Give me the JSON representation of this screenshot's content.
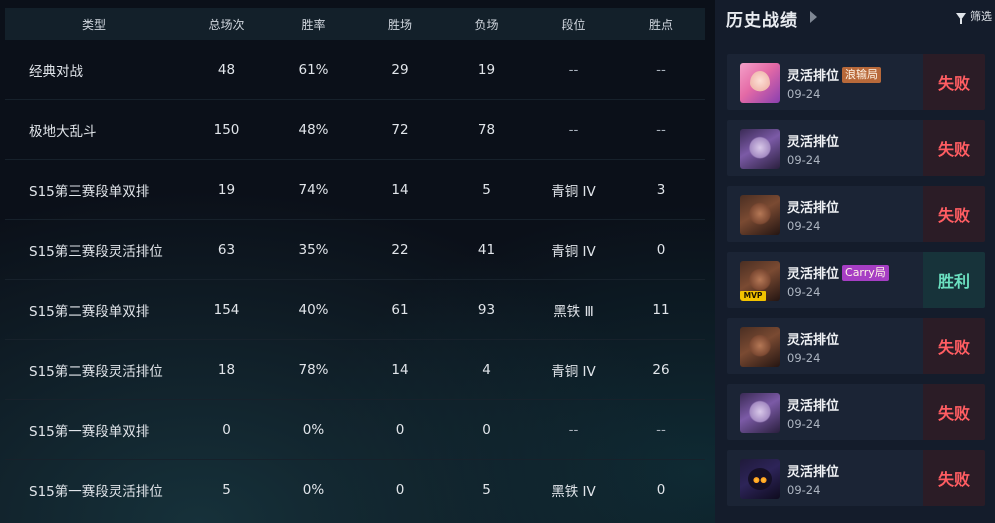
{
  "stats": {
    "headers": {
      "type": "类型",
      "total": "总场次",
      "rate": "胜率",
      "wins": "胜场",
      "losses": "负场",
      "rank": "段位",
      "lp": "胜点"
    },
    "rows": [
      {
        "type": "经典对战",
        "total": "48",
        "rate": "61%",
        "wins": "29",
        "losses": "19",
        "rank": "--",
        "lp": "--"
      },
      {
        "type": "极地大乱斗",
        "total": "150",
        "rate": "48%",
        "wins": "72",
        "losses": "78",
        "rank": "--",
        "lp": "--"
      },
      {
        "type": "S15第三赛段单双排",
        "total": "19",
        "rate": "74%",
        "wins": "14",
        "losses": "5",
        "rank": "青铜 IV",
        "lp": "3"
      },
      {
        "type": "S15第三赛段灵活排位",
        "total": "63",
        "rate": "35%",
        "wins": "22",
        "losses": "41",
        "rank": "青铜 IV",
        "lp": "0"
      },
      {
        "type": "S15第二赛段单双排",
        "total": "154",
        "rate": "40%",
        "wins": "61",
        "losses": "93",
        "rank": "黑铁 Ⅲ",
        "lp": "11"
      },
      {
        "type": "S15第二赛段灵活排位",
        "total": "18",
        "rate": "78%",
        "wins": "14",
        "losses": "4",
        "rank": "青铜 IV",
        "lp": "26"
      },
      {
        "type": "S15第一赛段单双排",
        "total": "0",
        "rate": "0%",
        "wins": "0",
        "losses": "0",
        "rank": "--",
        "lp": "--"
      },
      {
        "type": "S15第一赛段灵活排位",
        "total": "5",
        "rate": "0%",
        "wins": "0",
        "losses": "5",
        "rank": "黑铁 IV",
        "lp": "0"
      }
    ]
  },
  "history": {
    "title": "历史战绩",
    "filter_label": "筛选",
    "matches": [
      {
        "mode": "灵活排位",
        "badge": "浪输局",
        "date": "09-24",
        "result": "失败",
        "outcome": "defeat",
        "champion_icon": "champion-portrait-pink-hair",
        "mvp": ""
      },
      {
        "mode": "灵活排位",
        "badge": "",
        "date": "09-24",
        "result": "失败",
        "outcome": "defeat",
        "champion_icon": "champion-portrait-violet-hood",
        "mvp": ""
      },
      {
        "mode": "灵活排位",
        "badge": "",
        "date": "09-24",
        "result": "失败",
        "outcome": "defeat",
        "champion_icon": "champion-portrait-dark-skin",
        "mvp": ""
      },
      {
        "mode": "灵活排位",
        "badge": "Carry局",
        "date": "09-24",
        "result": "胜利",
        "outcome": "victory",
        "champion_icon": "champion-portrait-dark-skin",
        "mvp": "MVP"
      },
      {
        "mode": "灵活排位",
        "badge": "",
        "date": "09-24",
        "result": "失败",
        "outcome": "defeat",
        "champion_icon": "champion-portrait-dark-skin",
        "mvp": ""
      },
      {
        "mode": "灵活排位",
        "badge": "",
        "date": "09-24",
        "result": "失败",
        "outcome": "defeat",
        "champion_icon": "champion-portrait-violet-hood",
        "mvp": ""
      },
      {
        "mode": "灵活排位",
        "badge": "",
        "date": "09-24",
        "result": "失败",
        "outcome": "defeat",
        "champion_icon": "champion-portrait-dark-glowing-eyes",
        "mvp": ""
      }
    ]
  },
  "colors": {
    "defeat": "#ff5d62",
    "victory": "#6be0c0",
    "badge_lose": "#b8693a",
    "badge_carry": "#a63ec4",
    "mvp": "#f2c200"
  }
}
